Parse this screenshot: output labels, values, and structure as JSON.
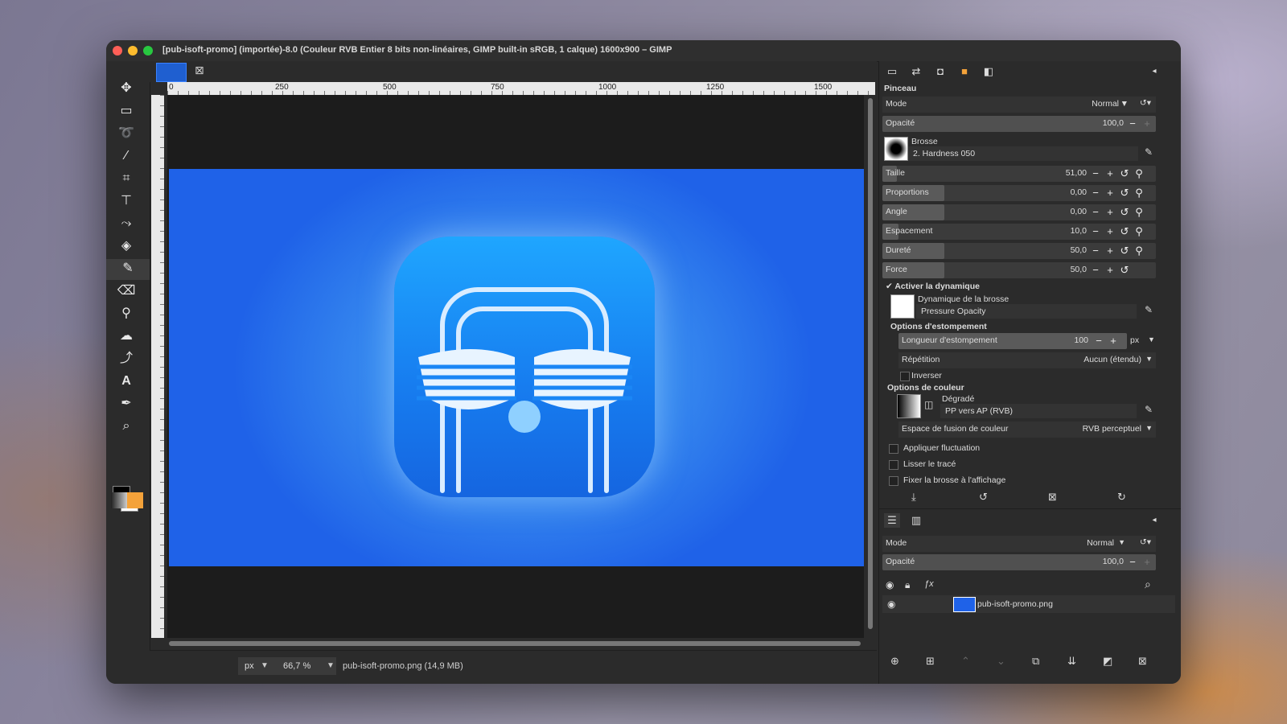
{
  "window": {
    "title": "[pub-isoft-promo] (importée)-8.0 (Couleur RVB Entier 8 bits non-linéaires, GIMP built-in sRGB, 1 calque) 1600x900 – GIMP"
  },
  "rulers": {
    "top_labels": [
      "0",
      "250",
      "500",
      "750",
      "1000",
      "1250",
      "1500"
    ]
  },
  "statusbar": {
    "unit": "px",
    "zoom": "66,7 %",
    "file": "pub-isoft-promo.png (14,9 MB)"
  },
  "tool_options": {
    "title": "Pinceau",
    "mode_label": "Mode",
    "mode_value": "Normal",
    "opacity_label": "Opacité",
    "opacity_value": "100,0",
    "brush_label": "Brosse",
    "brush_value": "2. Hardness 050",
    "sliders": [
      {
        "label": "Taille",
        "value": "51,00",
        "fraction": 0.12
      },
      {
        "label": "Proportions",
        "value": "0,00",
        "fraction": 0.5
      },
      {
        "label": "Angle",
        "value": "0,00",
        "fraction": 0.5
      },
      {
        "label": "Espacement",
        "value": "10,0",
        "fraction": 0.13
      },
      {
        "label": "Dureté",
        "value": "50,0",
        "fraction": 0.5
      },
      {
        "label": "Force",
        "value": "50,0",
        "fraction": 0.5
      }
    ],
    "dynamics_toggle": "Activer la dynamique",
    "dynamics_label": "Dynamique de la brosse",
    "dynamics_value": "Pressure Opacity",
    "fade_section": "Options d'estompement",
    "fade_length_label": "Longueur d'estompement",
    "fade_length_value": "100",
    "fade_unit": "px",
    "repeat_label": "Répétition",
    "repeat_value": "Aucun (étendu)",
    "invert_label": "Inverser",
    "color_section": "Options de couleur",
    "gradient_label": "Dégradé",
    "gradient_value": "PP vers AP (RVB)",
    "blend_space_label": "Espace de fusion de couleur",
    "blend_space_value": "RVB perceptuel",
    "jitter_label": "Appliquer fluctuation",
    "smooth_label": "Lisser le tracé",
    "lock_view_label": "Fixer la brosse à l'affichage"
  },
  "layers": {
    "mode_label": "Mode",
    "mode_value": "Normal",
    "opacity_label": "Opacité",
    "opacity_value": "100,0",
    "items": [
      {
        "name": "pub-isoft-promo.png"
      }
    ]
  },
  "colors": {
    "accent": "#3a82ff",
    "image_bg": "#1f62e8",
    "foreground": "#000000",
    "background": "#ffffff"
  }
}
